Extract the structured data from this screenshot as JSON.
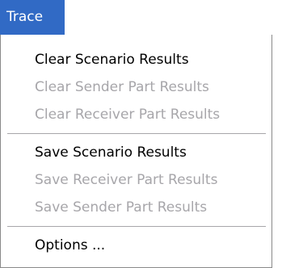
{
  "menu": {
    "title": "Trace",
    "groups": [
      {
        "items": [
          {
            "label": "Clear Scenario Results",
            "enabled": true
          },
          {
            "label": "Clear Sender Part Results",
            "enabled": false
          },
          {
            "label": "Clear Receiver Part Results",
            "enabled": false
          }
        ]
      },
      {
        "items": [
          {
            "label": "Save Scenario Results",
            "enabled": true
          },
          {
            "label": "Save Receiver Part Results",
            "enabled": false
          },
          {
            "label": "Save Sender Part Results",
            "enabled": false
          }
        ]
      },
      {
        "items": [
          {
            "label": "Options ...",
            "enabled": true
          }
        ]
      }
    ]
  },
  "colors": {
    "highlight": "#316ac5",
    "disabled_text": "#a7a6aa",
    "separator": "#a7a6aa",
    "border": "#8a8a8a"
  }
}
